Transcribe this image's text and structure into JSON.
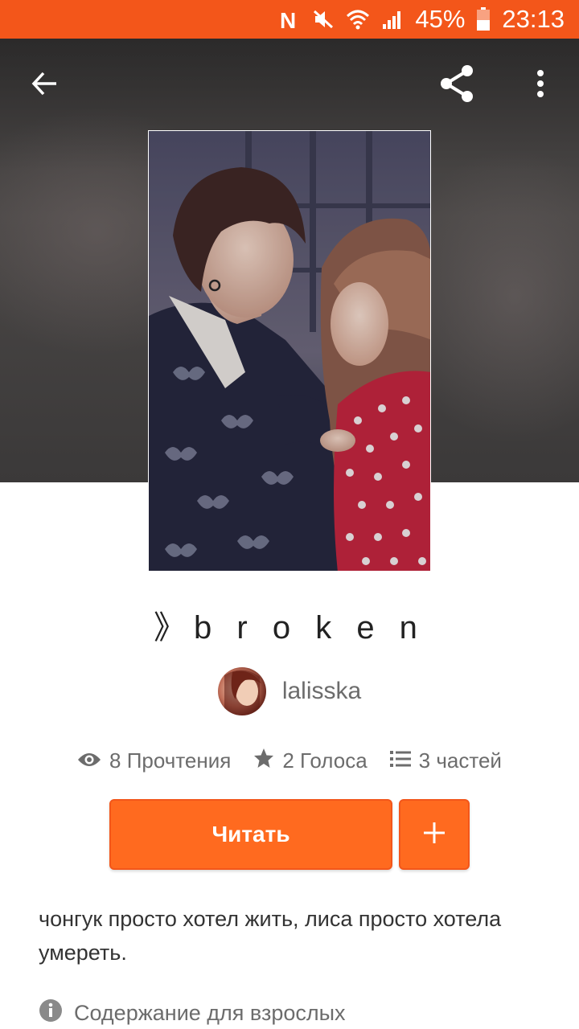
{
  "status_bar": {
    "battery": "45%",
    "time": "23:13",
    "icons": [
      "nfc-icon",
      "mute-icon",
      "wifi-icon",
      "signal-icon",
      "battery-icon"
    ]
  },
  "header": {
    "icons": [
      "back-arrow-icon",
      "share-icon",
      "more-vert-icon"
    ]
  },
  "story": {
    "title": "》b r o k e n",
    "author": "lalisska",
    "stats": {
      "reads": "8 Прочтения",
      "votes": "2 Голоса",
      "parts": "3 частей"
    },
    "read_button": "Читать",
    "add_button": "+",
    "description": "чонгук просто хотел жить, лиса просто хотела умереть.",
    "mature_label": "Содержание для взрослых"
  },
  "colors": {
    "accent": "#ff6a1f",
    "status_bar": "#f3561a",
    "text_secondary": "#6c6c6c"
  }
}
